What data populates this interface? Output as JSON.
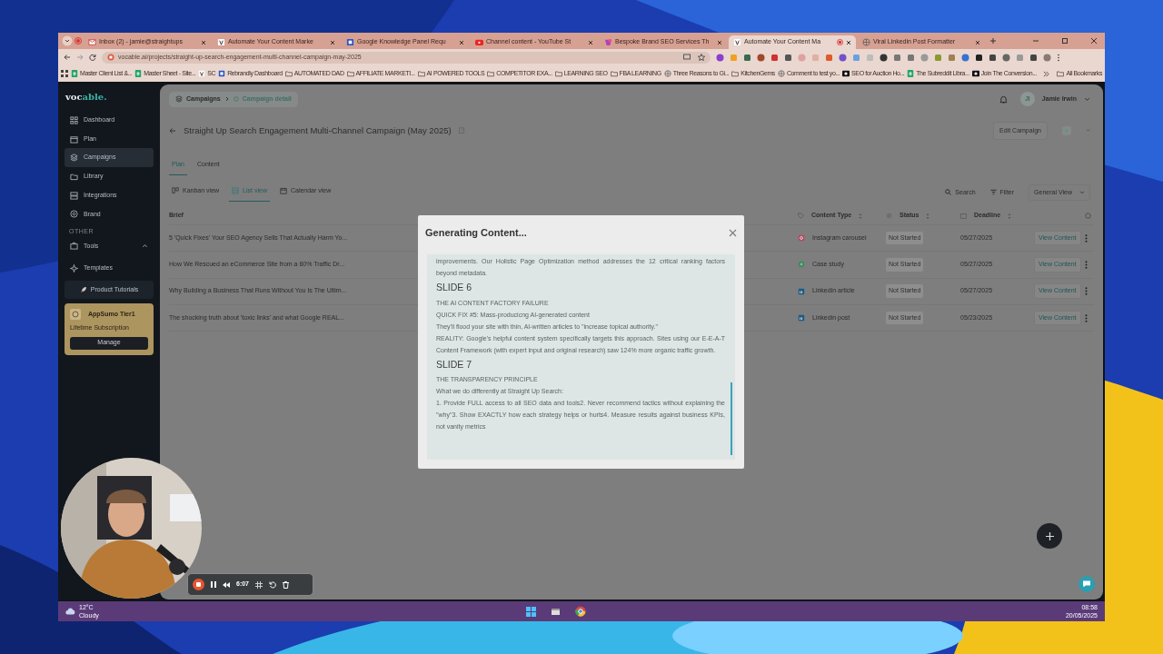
{
  "browser": {
    "tabs": [
      {
        "title": "Inbox (2) - jamie@straightups",
        "kind": "mail",
        "selected": false
      },
      {
        "title": "Automate Your Content Marke",
        "kind": "site",
        "selected": false
      },
      {
        "title": "Google Knowledge Panel Requ",
        "kind": "square",
        "selected": false
      },
      {
        "title": "Channel content - YouTube St",
        "kind": "video",
        "selected": false
      },
      {
        "title": "Bespoke Brand SEO Services Th",
        "kind": "brand",
        "selected": false
      },
      {
        "title": "Automate Your Content Ma",
        "kind": "site",
        "selected": true
      },
      {
        "title": "Viral Linkedin Post Formatter",
        "kind": "globe",
        "selected": false
      }
    ],
    "address": "vocable.ai/projects/straight-up-search-engagement-multi-channel-campaign-may-2025",
    "bookmarks": [
      {
        "label": "Master Client List &...",
        "kind": "sheet"
      },
      {
        "label": "Master Sheet - Site...",
        "kind": "sheet"
      },
      {
        "label": "SC",
        "kind": "site"
      },
      {
        "label": "Rebrandly Dashboard",
        "kind": "square"
      },
      {
        "label": "AUTOMATED DAD",
        "kind": "folder"
      },
      {
        "label": "AFFILIATE MARKETI...",
        "kind": "folder"
      },
      {
        "label": "AI POWERED TOOLS",
        "kind": "folder"
      },
      {
        "label": "COMPETITOR EXA...",
        "kind": "folder"
      },
      {
        "label": "LEARNING SEO",
        "kind": "folder"
      },
      {
        "label": "FBA LEARNING",
        "kind": "folder"
      },
      {
        "label": "Three Reasons to Gi...",
        "kind": "globe"
      },
      {
        "label": "KitchenGems",
        "kind": "folder"
      },
      {
        "label": "Comment to test yo...",
        "kind": "globe"
      },
      {
        "label": "SEO for Auction Ho...",
        "kind": "dark"
      },
      {
        "label": "The Subreddit Libra...",
        "kind": "sheet"
      },
      {
        "label": "Join The Conversion...",
        "kind": "dark"
      }
    ],
    "all_bookmarks": "All Bookmarks"
  },
  "app": {
    "logo": {
      "dark_part": "voc",
      "accent_part": "able."
    },
    "nav": [
      {
        "label": "Dashboard",
        "kind": "grid",
        "selected": false
      },
      {
        "label": "Plan",
        "kind": "calendar",
        "selected": false
      },
      {
        "label": "Campaigns",
        "kind": "layers",
        "selected": true
      },
      {
        "label": "Library",
        "kind": "folder",
        "selected": false
      },
      {
        "label": "Integrations",
        "kind": "server",
        "selected": false
      },
      {
        "label": "Brand",
        "kind": "circle",
        "selected": false
      }
    ],
    "section_label": "OTHER",
    "tools": {
      "label": "Tools",
      "expanded": true
    },
    "templates": {
      "label": "Templates"
    },
    "tutorials_button": "Product Tutorials",
    "plan_card": {
      "title": "AppSumo Tier1",
      "subtitle": "Lifetime Subscription",
      "button": "Manage"
    },
    "breadcrumbs": [
      "Campaigns",
      "Campaign detail"
    ],
    "user": {
      "initials": "JI",
      "name": "Jamie Irwin"
    },
    "title": "Straight Up Search Engagement Multi-Channel Campaign (May 2025)",
    "edit_button": "Edit Campaign",
    "page_tabs": [
      {
        "label": "Plan",
        "selected": true
      },
      {
        "label": "Content",
        "selected": false
      }
    ],
    "views": [
      {
        "label": "Kanban view",
        "kind": "kanban",
        "selected": false
      },
      {
        "label": "List view",
        "kind": "list",
        "selected": true
      },
      {
        "label": "Calendar view",
        "kind": "calendar",
        "selected": false
      }
    ],
    "search_label": "Search",
    "filter_label": "Filter",
    "view_select": "General View",
    "table": {
      "columns": [
        "Brief",
        "Content Type",
        "Status",
        "Deadline"
      ],
      "rows": [
        {
          "brief": "5 'Quick Fixes' Your SEO Agency Sells That Actually Harm Yo...",
          "content_type": "Instagram carousel",
          "kind": "instagram",
          "status": "Not Started",
          "deadline": "05/27/2025",
          "action": "View Content"
        },
        {
          "brief": "How We Rescued an eCommerce Site from a 60% Traffic Dr...",
          "content_type": "Case study",
          "kind": "case",
          "status": "Not Started",
          "deadline": "05/27/2025",
          "action": "View Content"
        },
        {
          "brief": "Why Building a Business That Runs Without You Is The Ultim...",
          "content_type": "Linkedin article",
          "kind": "linkedin",
          "status": "Not Started",
          "deadline": "05/27/2025",
          "action": "View Content"
        },
        {
          "brief": "The shocking truth about 'toxic links' and what Google REAL...",
          "content_type": "Linkedin post",
          "kind": "linkedin",
          "status": "Not Started",
          "deadline": "05/23/2025",
          "action": "View Content"
        }
      ]
    },
    "modal": {
      "title": "Generating Content...",
      "blocks": [
        {
          "kind": "text",
          "text": "improvements. Our Holistic Page Optimization method addresses the 12 critical ranking factors beyond metadata."
        },
        {
          "kind": "heading",
          "text": "SLIDE 6"
        },
        {
          "kind": "text",
          "text": "THE AI CONTENT FACTORY FAILURE"
        },
        {
          "kind": "text",
          "text": "QUICK FIX #5: Mass-producicng AI-generated content"
        },
        {
          "kind": "text",
          "text": "They'll flood your site with thin, AI-written articles to \"increase topical authority.\""
        },
        {
          "kind": "text",
          "text": "REALITY: Google's helpful content system specifically targets this approach. Sites using our E-E-A-T Content Framework (with expert input and original research) saw 124% more organic traffic growth."
        },
        {
          "kind": "heading",
          "text": "SLIDE 7"
        },
        {
          "kind": "text",
          "text": "THE TRANSPARENCY PRINCIPLE"
        },
        {
          "kind": "text",
          "text": "What we do differently at Straight Up Search:"
        },
        {
          "kind": "text",
          "text": "1. Provide FULL access to all SEO data and tools2. Never recommend tactics without explaining the \"why\"3. Show EXACTLY how each strategy helps or hurts4. Measure results against business KPIs, not vanity metrics"
        }
      ]
    }
  },
  "recorder": {
    "time": "6:07"
  },
  "taskbar": {
    "temperature": "12°C",
    "weather": "Cloudy",
    "time": "08:58",
    "date": "20/05/2025"
  }
}
